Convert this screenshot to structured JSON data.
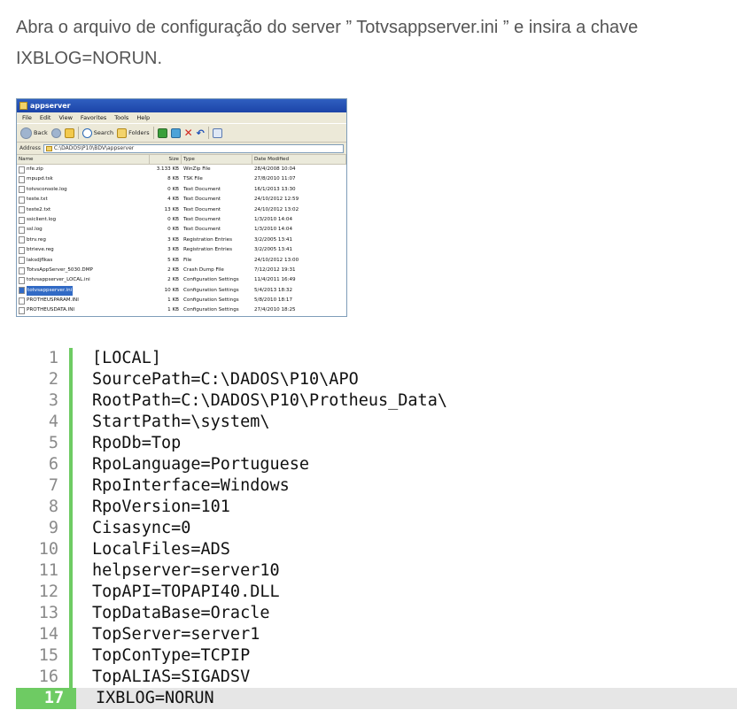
{
  "intro": {
    "text": "Abra o arquivo de configuração do server ” Totvsappserver.ini ” e insira a chave IXBLOG=NORUN."
  },
  "explorer": {
    "title": "appserver",
    "menu": [
      "File",
      "Edit",
      "View",
      "Favorites",
      "Tools",
      "Help"
    ],
    "toolbar": {
      "back": "Back",
      "search": "Search",
      "folders": "Folders"
    },
    "address_label": "Address",
    "address_value": "C:\\DADOS\\P10\\BDV\\appserver",
    "columns": {
      "name": "Name",
      "size": "Size",
      "type": "Type",
      "date": "Date Modified"
    },
    "files": [
      {
        "name": "nfe.zip",
        "size": "3.133 KB",
        "type": "WinZip File",
        "date": "28/4/2008 10:04"
      },
      {
        "name": "mpupd.tsk",
        "size": "8 KB",
        "type": "TSK File",
        "date": "27/8/2010 11:07"
      },
      {
        "name": "totvsconsole.log",
        "size": "0 KB",
        "type": "Text Document",
        "date": "16/1/2013 13:30"
      },
      {
        "name": "teste.txt",
        "size": "4 KB",
        "type": "Text Document",
        "date": "24/10/2012 12:59"
      },
      {
        "name": "teste2.txt",
        "size": "13 KB",
        "type": "Text Document",
        "date": "24/10/2012 13:02"
      },
      {
        "name": "ssiclient.log",
        "size": "0 KB",
        "type": "Text Document",
        "date": "1/3/2010 14:04"
      },
      {
        "name": "ssl.log",
        "size": "0 KB",
        "type": "Text Document",
        "date": "1/3/2010 14:04"
      },
      {
        "name": "btrv.reg",
        "size": "3 KB",
        "type": "Registration Entries",
        "date": "3/2/2005 13:41"
      },
      {
        "name": "btrieve.reg",
        "size": "3 KB",
        "type": "Registration Entries",
        "date": "3/2/2005 13:41"
      },
      {
        "name": "laksdjflkas",
        "size": "5 KB",
        "type": "File",
        "date": "24/10/2012 13:00"
      },
      {
        "name": "TotvsAppServer_5030.DMP",
        "size": "2 KB",
        "type": "Crash Dump File",
        "date": "7/12/2012 19:31"
      },
      {
        "name": "totvsappserver_LOCAL.ini",
        "size": "2 KB",
        "type": "Configuration Settings",
        "date": "11/4/2011 16:49"
      },
      {
        "name": "totvsappserver.ini",
        "size": "10 KB",
        "type": "Configuration Settings",
        "date": "5/4/2013 18:32",
        "selected": true
      },
      {
        "name": "PROTHEUSPARAM.INI",
        "size": "1 KB",
        "type": "Configuration Settings",
        "date": "5/8/2010 18:17"
      },
      {
        "name": "PROTHEUSDATA.INI",
        "size": "1 KB",
        "type": "Configuration Settings",
        "date": "27/4/2010 18:25"
      }
    ]
  },
  "code": {
    "highlight_line": 17,
    "lines": [
      "[LOCAL]",
      "SourcePath=C:\\DADOS\\P10\\APO",
      "RootPath=C:\\DADOS\\P10\\Protheus_Data\\",
      "StartPath=\\system\\",
      "RpoDb=Top",
      "RpoLanguage=Portuguese",
      "RpoInterface=Windows",
      "RpoVersion=101",
      "Cisasync=0",
      "LocalFiles=ADS",
      "helpserver=server10",
      "TopAPI=TOPAPI40.DLL",
      "TopDataBase=Oracle",
      "TopServer=server1",
      "TopConType=TCPIP",
      "TopALIAS=SIGADSV",
      "IXBLOG=NORUN"
    ]
  },
  "colors": {
    "gutter_green": "#6ecb63",
    "highlight_bg": "#e6e6e6",
    "selection_blue": "#316ac5"
  }
}
